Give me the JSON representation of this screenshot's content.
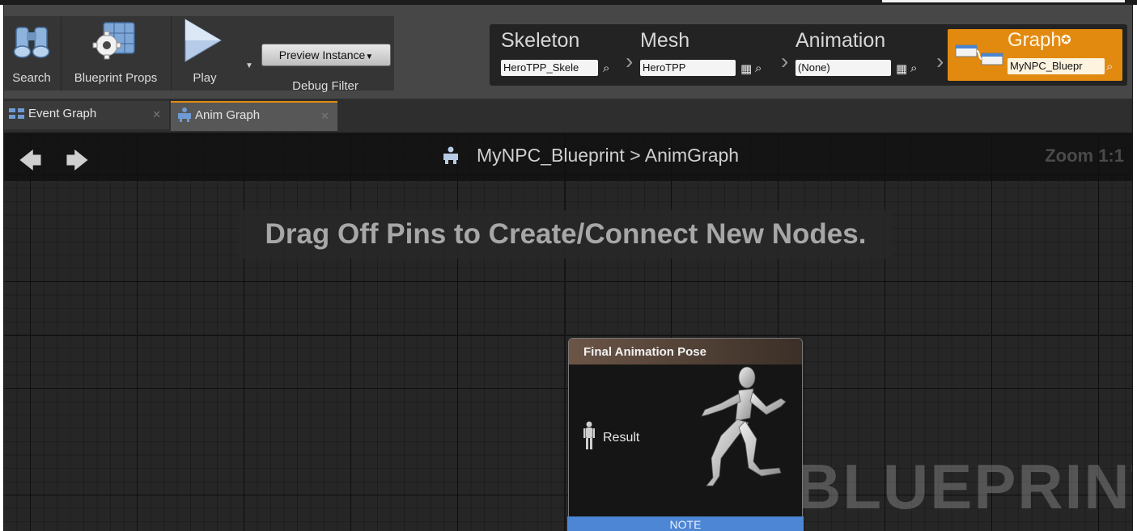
{
  "toolbar": {
    "search_label": "Search",
    "blueprint_props_label": "Blueprint Props",
    "play_label": "Play",
    "preview_instance_label": "Preview Instance",
    "debug_filter_label": "Debug Filter"
  },
  "modes": {
    "skeleton": {
      "title": "Skeleton",
      "value": "HeroTPP_Skele"
    },
    "mesh": {
      "title": "Mesh",
      "value": "HeroTPP"
    },
    "animation": {
      "title": "Animation",
      "value": "(None)"
    },
    "graph": {
      "title": "Graph",
      "value": "MyNPC_Bluepr"
    }
  },
  "tabs": [
    {
      "label": "Event Graph",
      "active": false
    },
    {
      "label": "Anim Graph",
      "active": true
    }
  ],
  "graph": {
    "breadcrumb_blueprint": "MyNPC_Blueprint",
    "breadcrumb_separator": ">",
    "breadcrumb_graph": "AnimGraph",
    "zoom": "Zoom 1:1",
    "hint": "Drag Off Pins to Create/Connect New Nodes.",
    "watermark": "BLUEPRINT"
  },
  "node": {
    "title": "Final Animation Pose",
    "pin_label": "Result",
    "note": "NOTE"
  },
  "colors": {
    "accent_orange": "#e28a10",
    "note_blue": "#4c86d4",
    "graph_background": "#262626"
  },
  "icons": [
    "binoculars-icon",
    "gear-grid-icon",
    "play-icon",
    "chevron-down-icon",
    "search-icon",
    "grid-icon",
    "graph-mode-icon",
    "star-icon",
    "event-graph-icon",
    "anim-graph-icon",
    "close-icon",
    "back-arrow-icon",
    "forward-arrow-icon",
    "mannequin-icon",
    "running-mannequin-icon"
  ]
}
